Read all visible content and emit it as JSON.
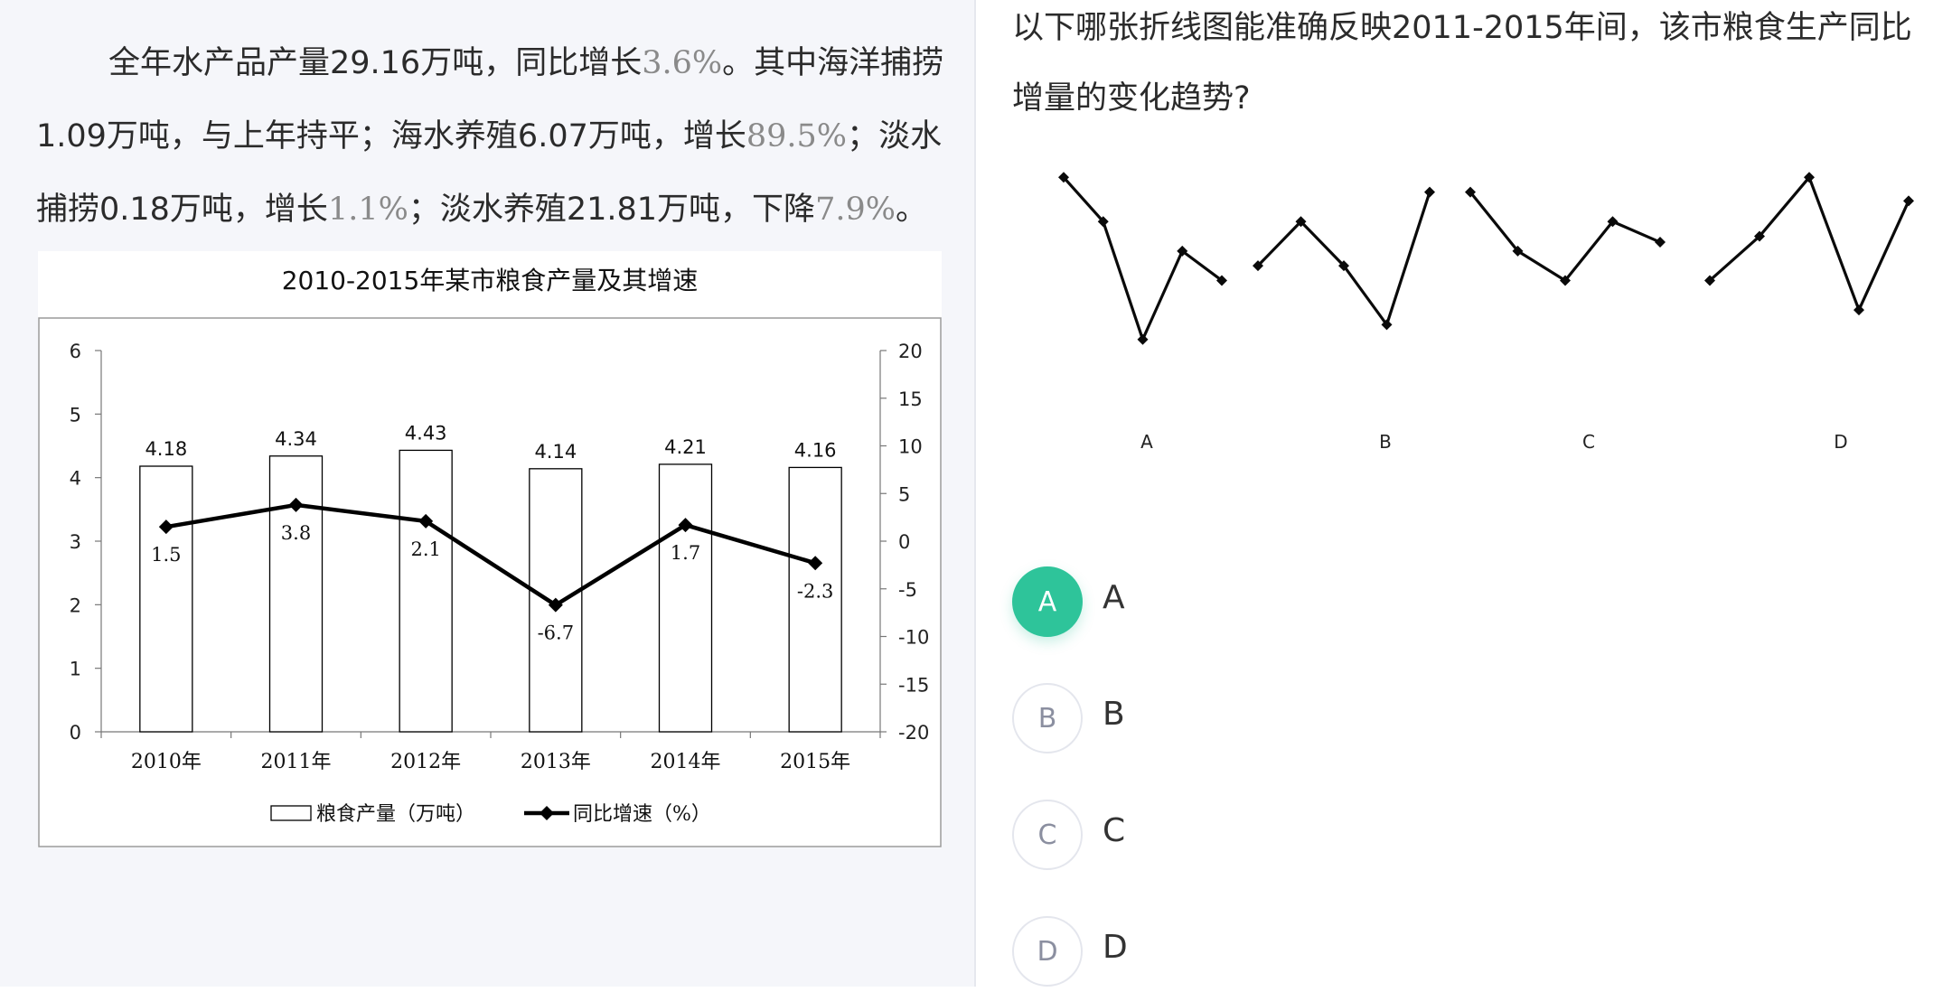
{
  "passage": {
    "seg1": "全年水产品产量29.16万吨，同比增长",
    "pct1": "3.6%",
    "seg2": "。其中海洋捕捞1.09万吨，与上年持平；海水养殖6.07万吨，增长",
    "pct2": "89.5%",
    "seg3": "；淡水捕捞0.18万吨，增长",
    "pct3": "1.1%",
    "seg4": "；淡水养殖21.81万吨，下降",
    "pct4": "7.9%",
    "seg5": "。"
  },
  "chart_data": {
    "type": "bar",
    "title": "2010-2015年某市粮食产量及其增速",
    "categories": [
      "2010年",
      "2011年",
      "2012年",
      "2013年",
      "2014年",
      "2015年"
    ],
    "series": [
      {
        "name": "粮食产量（万吨）",
        "type": "bar",
        "axis": "left",
        "values": [
          4.18,
          4.34,
          4.43,
          4.14,
          4.21,
          4.16
        ]
      },
      {
        "name": "同比增速（%）",
        "type": "line",
        "axis": "right",
        "values": [
          1.5,
          3.8,
          2.1,
          -6.7,
          1.7,
          -2.3
        ]
      }
    ],
    "bar_labels": [
      "4.18",
      "4.34",
      "4.43",
      "4.14",
      "4.21",
      "4.16"
    ],
    "line_labels": [
      "1.5",
      "3.8",
      "2.1",
      "-6.7",
      "1.7",
      "-2.3"
    ],
    "ylim_left": [
      0,
      6
    ],
    "ylim_right": [
      -20,
      20
    ],
    "left_ticks": [
      "0",
      "1",
      "2",
      "3",
      "4",
      "5",
      "6"
    ],
    "right_ticks": [
      "-20",
      "-15",
      "-10",
      "-5",
      "0",
      "5",
      "10",
      "15",
      "20"
    ],
    "legend_position": "bottom",
    "colors": {
      "bar_fill": "#ffffff",
      "bar_stroke": "#000000",
      "line": "#000000"
    }
  },
  "question": {
    "text": "以下哪张折线图能准确反映2011-2015年间，该市粮食生产同比增量的变化趋势?"
  },
  "option_charts": [
    {
      "label": "A",
      "values": [
        6,
        4.5,
        0.5,
        3.5,
        2.5
      ]
    },
    {
      "label": "B",
      "values": [
        3,
        4.5,
        3,
        1,
        5.5
      ]
    },
    {
      "label": "C",
      "values": [
        5.5,
        3.5,
        2.5,
        4.5,
        3.8
      ]
    },
    {
      "label": "D",
      "values": [
        2.5,
        4,
        6,
        1.5,
        5.2
      ]
    }
  ],
  "options": [
    {
      "letter": "A",
      "text": "A",
      "selected": true
    },
    {
      "letter": "B",
      "text": "B",
      "selected": false
    },
    {
      "letter": "C",
      "text": "C",
      "selected": false
    },
    {
      "letter": "D",
      "text": "D",
      "selected": false
    }
  ],
  "colors": {
    "accent": "#2ec49a"
  }
}
